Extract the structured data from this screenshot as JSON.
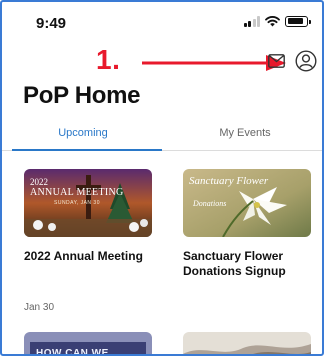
{
  "status_bar": {
    "time": "9:49",
    "icons": [
      "signal-icon",
      "wifi-icon",
      "battery-icon"
    ]
  },
  "annotation": {
    "label": "1.",
    "color": "#e8192c"
  },
  "header": {
    "title": "PoP Home",
    "icons": [
      "mail-icon",
      "profile-icon"
    ]
  },
  "tabs": [
    {
      "label": "Upcoming",
      "active": true
    },
    {
      "label": "My Events",
      "active": false
    }
  ],
  "accent_color": "#2a78c8",
  "events": [
    {
      "title": "2022 Annual Meeting",
      "image_text": [
        "2022",
        "ANNUAL MEETING",
        "SUNDAY, JAN 30"
      ]
    },
    {
      "title": "Sanctuary Flower Donations Signup",
      "image_text": [
        "Sanctuary Flower",
        "Donations"
      ]
    }
  ],
  "date_label": "Jan 30",
  "more_events": [
    {
      "image_text": "HOW CAN WE"
    }
  ]
}
